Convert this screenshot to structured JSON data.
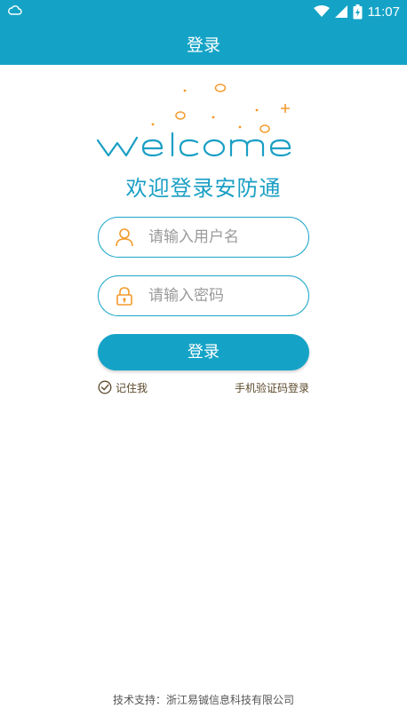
{
  "status_bar": {
    "time": "11:07",
    "icons": [
      "cloud-icon",
      "wifi-icon",
      "signal-icon",
      "battery-charging-icon"
    ]
  },
  "app_bar": {
    "title": "登录"
  },
  "welcome": {
    "logo_word": "welcome",
    "slogan": "欢迎登录安防通",
    "colors": {
      "word": "#1a9fc4",
      "accent": "#f39a2a"
    }
  },
  "form": {
    "username": {
      "placeholder": "请输入用户名",
      "value": "",
      "icon": "user-icon"
    },
    "password": {
      "placeholder": "请输入密码",
      "value": "",
      "icon": "lock-icon"
    },
    "login_button": "登录",
    "remember_me": {
      "label": "记住我",
      "checked": true
    },
    "sms_login": "手机验证码登录"
  },
  "footer": {
    "text": "技术支持：浙江易铖信息科技有限公司"
  },
  "colors": {
    "primary": "#14a3c6",
    "border": "#1ba6c9",
    "link_text": "#5c4a2c",
    "icon_accent": "#f39a2a"
  }
}
